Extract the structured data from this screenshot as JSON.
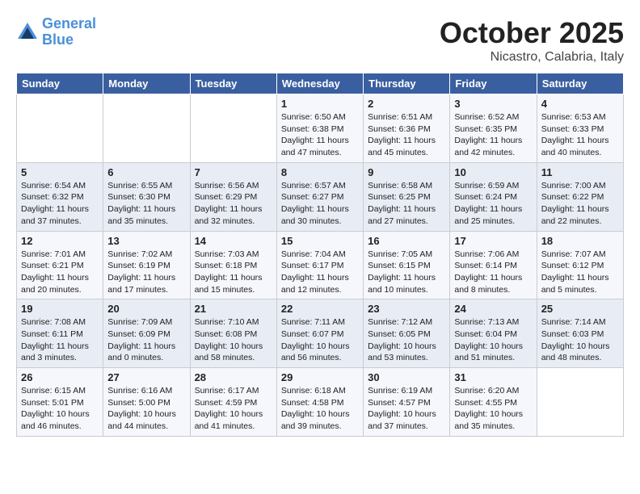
{
  "logo": {
    "line1": "General",
    "line2": "Blue"
  },
  "title": "October 2025",
  "subtitle": "Nicastro, Calabria, Italy",
  "weekdays": [
    "Sunday",
    "Monday",
    "Tuesday",
    "Wednesday",
    "Thursday",
    "Friday",
    "Saturday"
  ],
  "weeks": [
    [
      {
        "day": "",
        "info": ""
      },
      {
        "day": "",
        "info": ""
      },
      {
        "day": "",
        "info": ""
      },
      {
        "day": "1",
        "info": "Sunrise: 6:50 AM\nSunset: 6:38 PM\nDaylight: 11 hours\nand 47 minutes."
      },
      {
        "day": "2",
        "info": "Sunrise: 6:51 AM\nSunset: 6:36 PM\nDaylight: 11 hours\nand 45 minutes."
      },
      {
        "day": "3",
        "info": "Sunrise: 6:52 AM\nSunset: 6:35 PM\nDaylight: 11 hours\nand 42 minutes."
      },
      {
        "day": "4",
        "info": "Sunrise: 6:53 AM\nSunset: 6:33 PM\nDaylight: 11 hours\nand 40 minutes."
      }
    ],
    [
      {
        "day": "5",
        "info": "Sunrise: 6:54 AM\nSunset: 6:32 PM\nDaylight: 11 hours\nand 37 minutes."
      },
      {
        "day": "6",
        "info": "Sunrise: 6:55 AM\nSunset: 6:30 PM\nDaylight: 11 hours\nand 35 minutes."
      },
      {
        "day": "7",
        "info": "Sunrise: 6:56 AM\nSunset: 6:29 PM\nDaylight: 11 hours\nand 32 minutes."
      },
      {
        "day": "8",
        "info": "Sunrise: 6:57 AM\nSunset: 6:27 PM\nDaylight: 11 hours\nand 30 minutes."
      },
      {
        "day": "9",
        "info": "Sunrise: 6:58 AM\nSunset: 6:25 PM\nDaylight: 11 hours\nand 27 minutes."
      },
      {
        "day": "10",
        "info": "Sunrise: 6:59 AM\nSunset: 6:24 PM\nDaylight: 11 hours\nand 25 minutes."
      },
      {
        "day": "11",
        "info": "Sunrise: 7:00 AM\nSunset: 6:22 PM\nDaylight: 11 hours\nand 22 minutes."
      }
    ],
    [
      {
        "day": "12",
        "info": "Sunrise: 7:01 AM\nSunset: 6:21 PM\nDaylight: 11 hours\nand 20 minutes."
      },
      {
        "day": "13",
        "info": "Sunrise: 7:02 AM\nSunset: 6:19 PM\nDaylight: 11 hours\nand 17 minutes."
      },
      {
        "day": "14",
        "info": "Sunrise: 7:03 AM\nSunset: 6:18 PM\nDaylight: 11 hours\nand 15 minutes."
      },
      {
        "day": "15",
        "info": "Sunrise: 7:04 AM\nSunset: 6:17 PM\nDaylight: 11 hours\nand 12 minutes."
      },
      {
        "day": "16",
        "info": "Sunrise: 7:05 AM\nSunset: 6:15 PM\nDaylight: 11 hours\nand 10 minutes."
      },
      {
        "day": "17",
        "info": "Sunrise: 7:06 AM\nSunset: 6:14 PM\nDaylight: 11 hours\nand 8 minutes."
      },
      {
        "day": "18",
        "info": "Sunrise: 7:07 AM\nSunset: 6:12 PM\nDaylight: 11 hours\nand 5 minutes."
      }
    ],
    [
      {
        "day": "19",
        "info": "Sunrise: 7:08 AM\nSunset: 6:11 PM\nDaylight: 11 hours\nand 3 minutes."
      },
      {
        "day": "20",
        "info": "Sunrise: 7:09 AM\nSunset: 6:09 PM\nDaylight: 11 hours\nand 0 minutes."
      },
      {
        "day": "21",
        "info": "Sunrise: 7:10 AM\nSunset: 6:08 PM\nDaylight: 10 hours\nand 58 minutes."
      },
      {
        "day": "22",
        "info": "Sunrise: 7:11 AM\nSunset: 6:07 PM\nDaylight: 10 hours\nand 56 minutes."
      },
      {
        "day": "23",
        "info": "Sunrise: 7:12 AM\nSunset: 6:05 PM\nDaylight: 10 hours\nand 53 minutes."
      },
      {
        "day": "24",
        "info": "Sunrise: 7:13 AM\nSunset: 6:04 PM\nDaylight: 10 hours\nand 51 minutes."
      },
      {
        "day": "25",
        "info": "Sunrise: 7:14 AM\nSunset: 6:03 PM\nDaylight: 10 hours\nand 48 minutes."
      }
    ],
    [
      {
        "day": "26",
        "info": "Sunrise: 6:15 AM\nSunset: 5:01 PM\nDaylight: 10 hours\nand 46 minutes."
      },
      {
        "day": "27",
        "info": "Sunrise: 6:16 AM\nSunset: 5:00 PM\nDaylight: 10 hours\nand 44 minutes."
      },
      {
        "day": "28",
        "info": "Sunrise: 6:17 AM\nSunset: 4:59 PM\nDaylight: 10 hours\nand 41 minutes."
      },
      {
        "day": "29",
        "info": "Sunrise: 6:18 AM\nSunset: 4:58 PM\nDaylight: 10 hours\nand 39 minutes."
      },
      {
        "day": "30",
        "info": "Sunrise: 6:19 AM\nSunset: 4:57 PM\nDaylight: 10 hours\nand 37 minutes."
      },
      {
        "day": "31",
        "info": "Sunrise: 6:20 AM\nSunset: 4:55 PM\nDaylight: 10 hours\nand 35 minutes."
      },
      {
        "day": "",
        "info": ""
      }
    ]
  ]
}
